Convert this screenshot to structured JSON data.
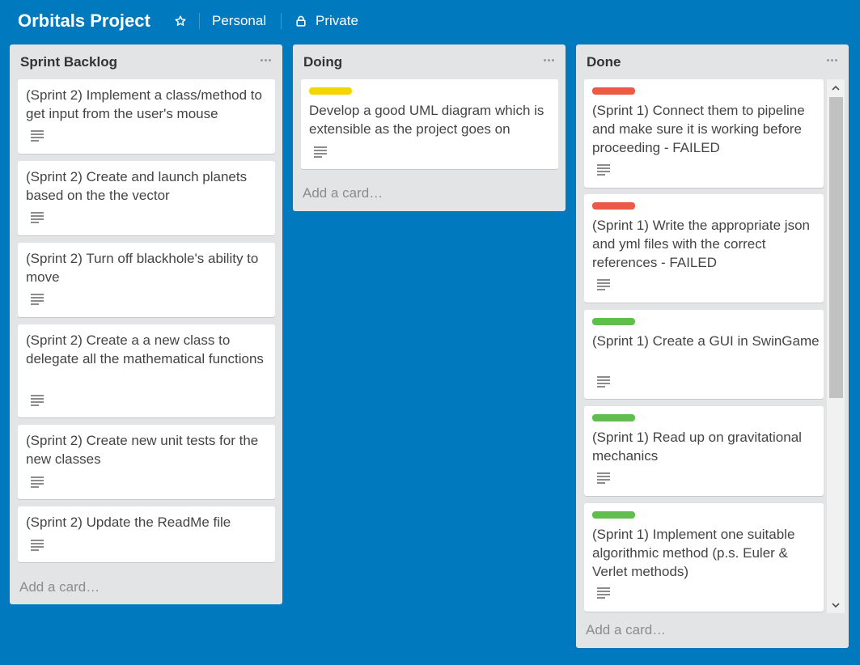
{
  "board": {
    "title": "Orbitals Project",
    "visibility_team": "Personal",
    "visibility_privacy": "Private"
  },
  "colors": {
    "background": "#0079bf",
    "list_bg": "#e2e4e6",
    "label_yellow": "#f2d600",
    "label_red": "#eb5a46",
    "label_green": "#61bd4f"
  },
  "icons": [
    "star-icon",
    "lock-icon",
    "ellipsis-icon",
    "description-icon",
    "chevron-up-icon",
    "chevron-down-icon"
  ],
  "lists": [
    {
      "name": "Sprint Backlog",
      "add_card": "Add a card…",
      "cards": [
        {
          "title": "(Sprint 2) Implement a class/method to get input from the user's mouse",
          "label": null,
          "has_description": true
        },
        {
          "title": "(Sprint 2) Create and launch planets based on the the vector",
          "label": null,
          "has_description": true
        },
        {
          "title": "(Sprint 2) Turn off blackhole's ability to move",
          "label": null,
          "has_description": true
        },
        {
          "title": "(Sprint 2) Create a a new class to delegate all the mathematical functions",
          "label": null,
          "has_description": true
        },
        {
          "title": "(Sprint 2) Create new unit tests for the new classes",
          "label": null,
          "has_description": true
        },
        {
          "title": "(Sprint 2) Update the ReadMe file",
          "label": null,
          "has_description": true
        }
      ]
    },
    {
      "name": "Doing",
      "add_card": "Add a card…",
      "cards": [
        {
          "title": "Develop a good UML diagram which is extensible as the project goes on",
          "label": "yellow",
          "has_description": true
        }
      ]
    },
    {
      "name": "Done",
      "add_card": "Add a card…",
      "cards": [
        {
          "title": "(Sprint 1) Connect them to pipeline and make sure it is working before proceeding - FAILED",
          "label": "red",
          "has_description": true
        },
        {
          "title": "(Sprint 1) Write the appropriate json and yml files with the correct references - FAILED",
          "label": "red",
          "has_description": true
        },
        {
          "title": "(Sprint 1) Create a GUI in SwinGame",
          "label": "green",
          "has_description": true
        },
        {
          "title": "(Sprint 1) Read up on gravitational mechanics",
          "label": "green",
          "has_description": true
        },
        {
          "title": "(Sprint 1) Implement one suitable algorithmic method (p.s. Euler & Verlet methods)",
          "label": "green",
          "has_description": true
        }
      ]
    }
  ]
}
